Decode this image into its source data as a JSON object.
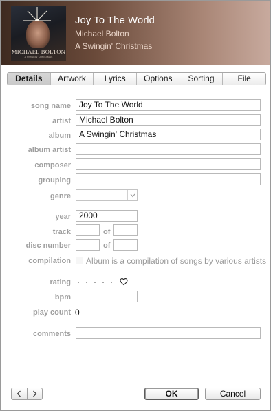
{
  "header": {
    "title": "Joy To The World",
    "artist": "Michael Bolton",
    "album": "A Swingin' Christmas",
    "artwork": {
      "text": "MICHAEL BOLTON",
      "subtext": "A SWINGIN' CHRISTMAS"
    }
  },
  "tabs": [
    {
      "label": "Details",
      "active": true
    },
    {
      "label": "Artwork"
    },
    {
      "label": "Lyrics"
    },
    {
      "label": "Options"
    },
    {
      "label": "Sorting"
    },
    {
      "label": "File"
    }
  ],
  "labels": {
    "song_name": "song name",
    "artist": "artist",
    "album": "album",
    "album_artist": "album artist",
    "composer": "composer",
    "grouping": "grouping",
    "genre": "genre",
    "year": "year",
    "track": "track",
    "disc_number": "disc number",
    "of": "of",
    "compilation": "compilation",
    "rating": "rating",
    "bpm": "bpm",
    "play_count": "play count",
    "comments": "comments"
  },
  "fields": {
    "song_name": "Joy To The World",
    "artist": "Michael Bolton",
    "album": "A Swingin' Christmas",
    "album_artist": "",
    "composer": "",
    "grouping": "",
    "genre": "",
    "year": "2000",
    "track": "",
    "track_of": "",
    "disc_number": "",
    "disc_of": "",
    "bpm": "",
    "comments": ""
  },
  "compilation": {
    "checked": false,
    "text": "Album is a compilation of songs by various artists"
  },
  "rating": {
    "stars": 0,
    "max": 5,
    "loved": false
  },
  "play_count": "0",
  "buttons": {
    "ok": "OK",
    "cancel": "Cancel"
  },
  "icons": {
    "prev": "chevron-left-icon",
    "next": "chevron-right-icon",
    "heart": "heart-icon",
    "genre_dropdown": "chevron-down-icon"
  }
}
